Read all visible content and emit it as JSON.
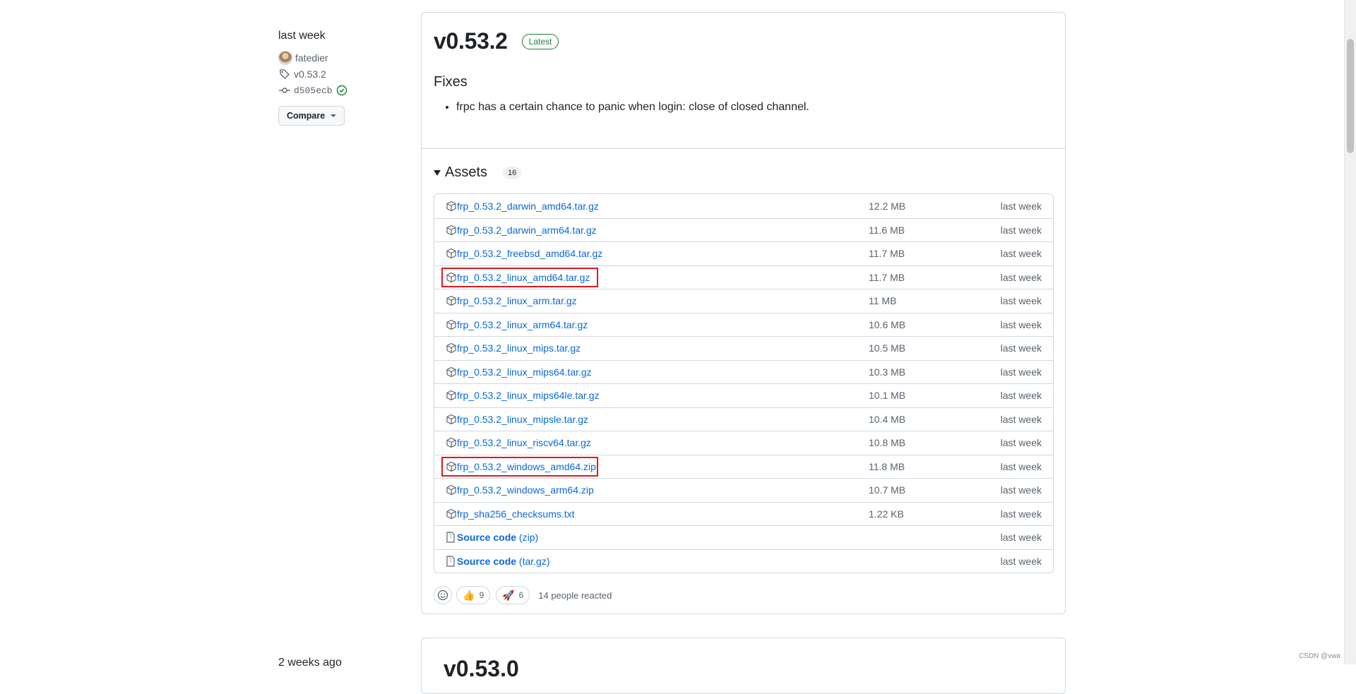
{
  "meta": {
    "when": "last week",
    "author": "fatedier",
    "tag": "v0.53.2",
    "commit": "d505ecb",
    "compare_label": "Compare"
  },
  "release": {
    "version": "v0.53.2",
    "badge": "Latest",
    "fixes_heading": "Fixes",
    "fixes": [
      "frpc has a certain chance to panic when login: close of closed channel."
    ],
    "assets_heading": "Assets",
    "assets_count": "16",
    "assets": [
      {
        "name": "frp_0.53.2_darwin_amd64.tar.gz",
        "size": "12.2 MB",
        "date": "last week"
      },
      {
        "name": "frp_0.53.2_darwin_arm64.tar.gz",
        "size": "11.6 MB",
        "date": "last week"
      },
      {
        "name": "frp_0.53.2_freebsd_amd64.tar.gz",
        "size": "11.7 MB",
        "date": "last week"
      },
      {
        "name": "frp_0.53.2_linux_amd64.tar.gz",
        "size": "11.7 MB",
        "date": "last week"
      },
      {
        "name": "frp_0.53.2_linux_arm.tar.gz",
        "size": "11 MB",
        "date": "last week"
      },
      {
        "name": "frp_0.53.2_linux_arm64.tar.gz",
        "size": "10.6 MB",
        "date": "last week"
      },
      {
        "name": "frp_0.53.2_linux_mips.tar.gz",
        "size": "10.5 MB",
        "date": "last week"
      },
      {
        "name": "frp_0.53.2_linux_mips64.tar.gz",
        "size": "10.3 MB",
        "date": "last week"
      },
      {
        "name": "frp_0.53.2_linux_mips64le.tar.gz",
        "size": "10.1 MB",
        "date": "last week"
      },
      {
        "name": "frp_0.53.2_linux_mipsle.tar.gz",
        "size": "10.4 MB",
        "date": "last week"
      },
      {
        "name": "frp_0.53.2_linux_riscv64.tar.gz",
        "size": "10.8 MB",
        "date": "last week"
      },
      {
        "name": "frp_0.53.2_windows_amd64.zip",
        "size": "11.8 MB",
        "date": "last week"
      },
      {
        "name": "frp_0.53.2_windows_arm64.zip",
        "size": "10.7 MB",
        "date": "last week"
      },
      {
        "name": "frp_sha256_checksums.txt",
        "size": "1.22 KB",
        "date": "last week"
      },
      {
        "name": "Source code",
        "suffix": "(zip)",
        "size": "",
        "date": "last week"
      },
      {
        "name": "Source code",
        "suffix": "(tar.gz)",
        "size": "",
        "date": "last week"
      }
    ],
    "reactions": {
      "thumbs_count": "9",
      "rocket_count": "6",
      "summary": "14 people reacted"
    }
  },
  "next_release": {
    "when": "2 weeks ago",
    "version": "v0.53.0"
  },
  "watermark": "CSDN @vwa"
}
